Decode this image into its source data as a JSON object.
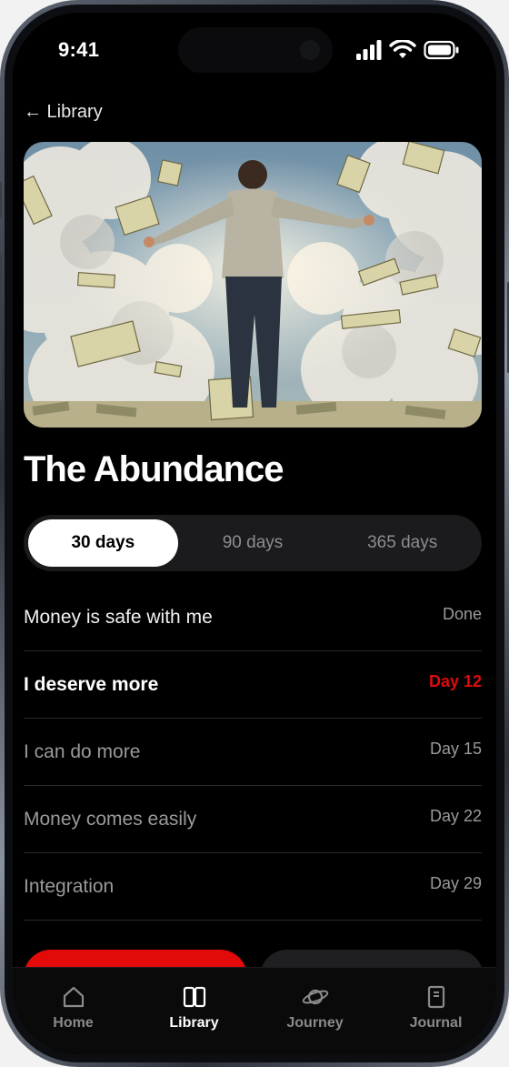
{
  "status": {
    "time": "9:41"
  },
  "nav": {
    "back_label": "← Library"
  },
  "program": {
    "title": "The Abundance"
  },
  "durations": [
    {
      "label": "30 days",
      "active": true
    },
    {
      "label": "90 days",
      "active": false
    },
    {
      "label": "365 days",
      "active": false
    }
  ],
  "sessions": [
    {
      "name": "Money is safe with me",
      "status": "Done",
      "state": "done"
    },
    {
      "name": "I deserve more",
      "status": "Day 12",
      "state": "current"
    },
    {
      "name": "I can do more",
      "status": "Day 15",
      "state": "future"
    },
    {
      "name": "Money comes easily",
      "status": "Day 22",
      "state": "future"
    },
    {
      "name": "Integration",
      "status": "Day 29",
      "state": "future"
    }
  ],
  "tabs": [
    {
      "label": "Home",
      "icon": "home-icon",
      "active": false
    },
    {
      "label": "Library",
      "icon": "library-icon",
      "active": true
    },
    {
      "label": "Journey",
      "icon": "planet-icon",
      "active": false
    },
    {
      "label": "Journal",
      "icon": "journal-icon",
      "active": false
    }
  ],
  "colors": {
    "accent": "#e30a0a",
    "background": "#000000",
    "segment_bg": "#1b1b1d"
  }
}
